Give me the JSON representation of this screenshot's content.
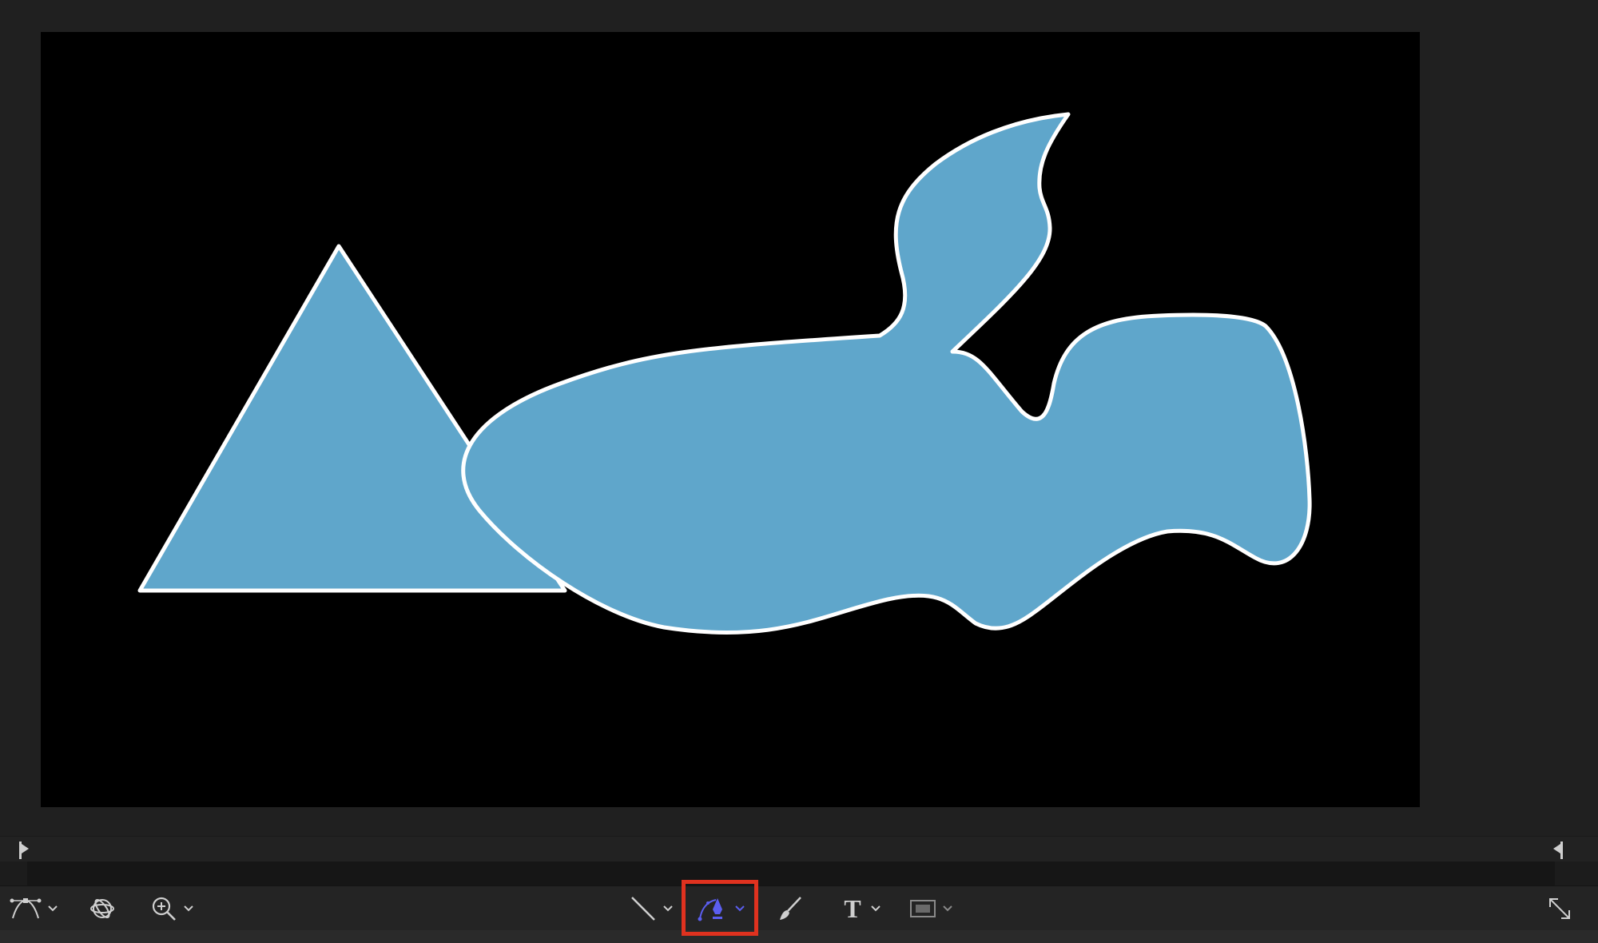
{
  "colors": {
    "app_background": "#202020",
    "canvas_background": "#000000",
    "shape_fill": "#5fa6cb",
    "shape_stroke": "#ffffff",
    "toolbar_background": "#242424",
    "icon_color": "#cfcfcf",
    "active_tool_color": "#5b5ef0",
    "highlight_border": "#e0321f"
  },
  "canvas": {
    "shapes": [
      {
        "name": "triangle",
        "kind": "polygon"
      },
      {
        "name": "freeform-bezier-shape",
        "kind": "bezier"
      }
    ]
  },
  "timeline": {
    "play_range_start_icon": "play-range-in-marker-icon",
    "play_range_end_icon": "play-range-out-marker-icon"
  },
  "toolbar": {
    "tools": [
      {
        "name": "adjust-shape-tool",
        "icon": "bezier-adjust-icon",
        "has_menu": true
      },
      {
        "name": "3d-transform-tool",
        "icon": "orbit-3d-icon",
        "has_menu": false
      },
      {
        "name": "zoom-tool",
        "icon": "zoom-in-icon",
        "has_menu": true
      },
      {
        "name": "line-tool",
        "icon": "line-icon",
        "has_menu": true
      },
      {
        "name": "bezier-pen-tool",
        "icon": "pen-bezier-icon",
        "has_menu": true,
        "active": true,
        "highlighted": true
      },
      {
        "name": "paint-stroke-tool",
        "icon": "brush-icon",
        "has_menu": false
      },
      {
        "name": "text-tool",
        "icon": "text-icon",
        "label": "T",
        "has_menu": true
      },
      {
        "name": "mask-rectangle-tool",
        "icon": "rectangle-mask-icon",
        "has_menu": true
      },
      {
        "name": "fullscreen-toggle",
        "icon": "expand-icon",
        "has_menu": false
      }
    ]
  }
}
